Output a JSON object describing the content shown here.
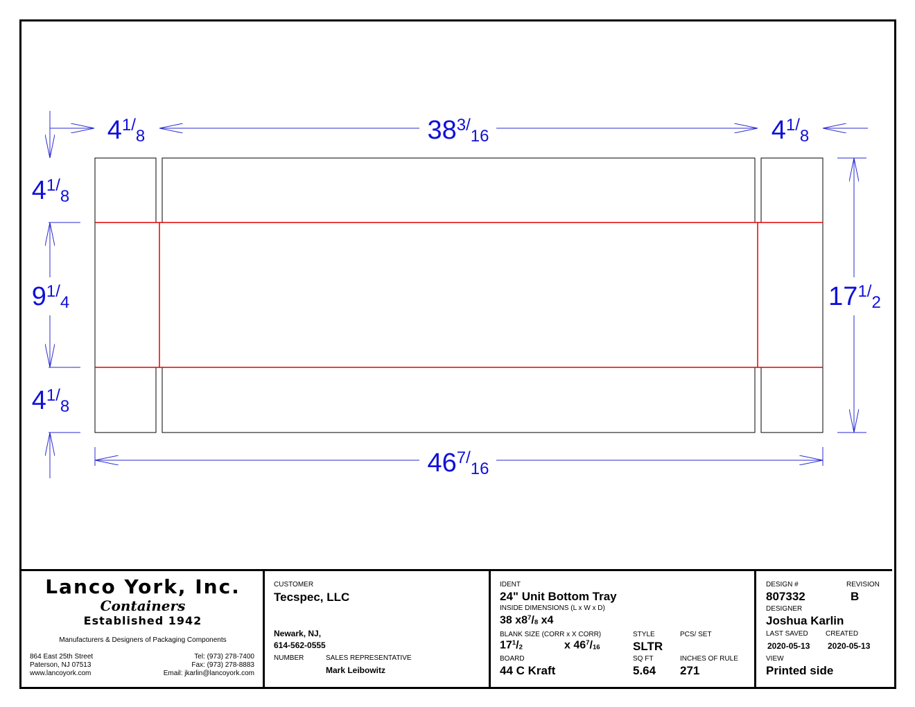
{
  "dimensions": {
    "top_left_flap": "4 1/8",
    "top_center_panel": "38 3/16",
    "top_right_flap": "4 1/8",
    "left_top_flap": "4 1/8",
    "left_middle": "9 1/4",
    "left_bottom_flap": "4 1/8",
    "right_total": "17 1/2",
    "bottom_total": "46 7/16"
  },
  "colors": {
    "dimension": "#1010d8",
    "fold_line": "#e00000",
    "cut_line": "#000000"
  },
  "company": {
    "name": "Lanco York, Inc.",
    "sub": "Containers",
    "established": "Established 1942",
    "tagline": "Manufacturers & Designers of Packaging Components",
    "address1": "864 East 25th Street",
    "address2": "Paterson, NJ  07513",
    "website": "www.lancoyork.com",
    "tel": "Tel: (973) 278-7400",
    "fax": "Fax: (973) 278-8883",
    "email": "Email: jkarlin@lancoyork.com"
  },
  "customer": {
    "label": "CUSTOMER",
    "name": "Tecspec, LLC",
    "city": "Newark, NJ,",
    "phone": "614-562-0555",
    "number_label": "NUMBER",
    "sales_rep_label": "SALES REPRESENTATIVE",
    "sales_rep": "Mark Leibowitz"
  },
  "spec": {
    "ident_label": "IDENT",
    "ident": "24\" Unit Bottom Tray",
    "inside_label": "INSIDE DIMENSIONS (L x W x D)",
    "inside_a": "38 x8",
    "inside_frac_num": "7",
    "inside_frac_den": "8",
    "inside_b": " x4",
    "blank_label": "BLANK SIZE (CORR x X CORR)",
    "blank_a": "17",
    "blank_a_num": "1",
    "blank_a_den": "2",
    "blank_b": "x 46",
    "blank_b_num": "7",
    "blank_b_den": "16",
    "style_label": "STYLE",
    "style": "SLTR",
    "pcs_label": "PCS/ SET",
    "pcs": "",
    "board_label": "BOARD",
    "board": "44 C Kraft",
    "sqft_label": "SQ FT",
    "sqft": "5.64",
    "rule_label": "INCHES OF RULE",
    "rule": "271"
  },
  "design": {
    "design_label": "DESIGN #",
    "design": "807332",
    "revision_label": "REVISION",
    "revision": "B",
    "designer_label": "DESIGNER",
    "designer": "Joshua Karlin",
    "saved_label": "LAST SAVED",
    "saved": "2020-05-13",
    "created_label": "CREATED",
    "created": "2020-05-13",
    "view_label": "VIEW",
    "view": "Printed side"
  }
}
